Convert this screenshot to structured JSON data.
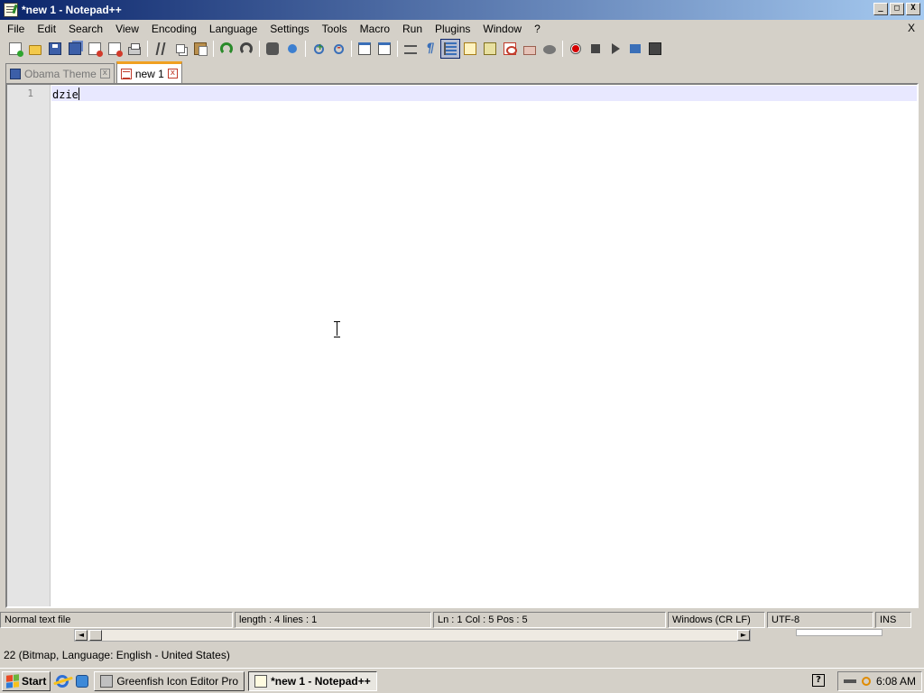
{
  "window": {
    "title": "*new 1 - Notepad++",
    "menu_close": "X"
  },
  "window_buttons": {
    "minimize": "_",
    "maximize": "□",
    "close": "X"
  },
  "menu": [
    "File",
    "Edit",
    "Search",
    "View",
    "Encoding",
    "Language",
    "Settings",
    "Tools",
    "Macro",
    "Run",
    "Plugins",
    "Window",
    "?"
  ],
  "toolbar": {
    "icons": [
      "new-file-icon",
      "open-file-icon",
      "save-icon",
      "save-all-icon",
      "close-icon",
      "close-all-icon",
      "print-icon",
      "cut-icon",
      "copy-icon",
      "paste-icon",
      "undo-icon",
      "redo-icon",
      "find-icon",
      "replace-icon",
      "zoom-in-icon",
      "zoom-out-icon",
      "sync-vertical-icon",
      "sync-horizontal-icon",
      "word-wrap-icon",
      "show-all-characters-icon",
      "indent-guide-icon",
      "document-map-icon",
      "function-list-icon",
      "pdf-icon",
      "folder-workspace-icon",
      "monitoring-icon",
      "record-macro-icon",
      "stop-recording-icon",
      "playback-icon",
      "run-macro-multiple-icon",
      "save-macro-icon"
    ],
    "active": "indent-guide-icon"
  },
  "tabs": [
    {
      "label": "Obama Theme",
      "active": false,
      "close": "x"
    },
    {
      "label": "new 1",
      "active": true,
      "close": "x"
    }
  ],
  "editor": {
    "line_numbers": [
      "1"
    ],
    "lines": [
      "dzie"
    ]
  },
  "status": {
    "file_type": "Normal text file",
    "length": "length : 4    lines : 1",
    "position": "Ln : 1    Col : 5    Pos : 5",
    "eol": "Windows (CR LF)",
    "encoding": "UTF-8",
    "mode": "INS"
  },
  "background_window": {
    "status_text": "22 (Bitmap, Language: English - United States)",
    "scroll_left": "◄",
    "scroll_right": "►"
  },
  "taskbar": {
    "start_label": "Start",
    "buttons": [
      {
        "label": "Greenfish Icon Editor Pro",
        "active": false
      },
      {
        "label": "*new 1 - Notepad++",
        "active": true
      }
    ],
    "help_label": "?",
    "clock": "6:08 AM"
  }
}
